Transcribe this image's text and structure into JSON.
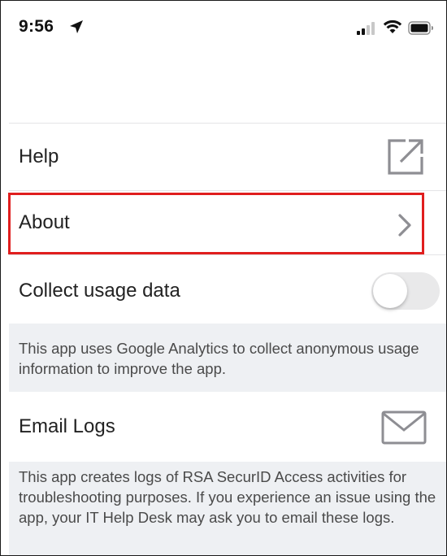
{
  "status_bar": {
    "time": "9:56",
    "icons": [
      "location-arrow-icon",
      "signal-icon",
      "wifi-icon",
      "battery-icon"
    ]
  },
  "settings": {
    "help": {
      "label": "Help",
      "icon": "external-link-icon"
    },
    "about": {
      "label": "About",
      "icon": "chevron-right-icon"
    },
    "collect_usage": {
      "label": "Collect usage data",
      "toggle_on": false,
      "note": "This app uses Google Analytics to collect anonymous usage information to improve the app."
    },
    "email_logs": {
      "label": "Email Logs",
      "icon": "mail-icon",
      "note": "This app creates logs of RSA SecurID Access activities for troubleshooting purposes. If you experience an issue using the app, your IT Help Desk may ask you to email these logs."
    }
  },
  "colors": {
    "highlight": "#e01e1e",
    "note_background": "#eef0f3",
    "toggle_off": "#e9e9ea"
  }
}
